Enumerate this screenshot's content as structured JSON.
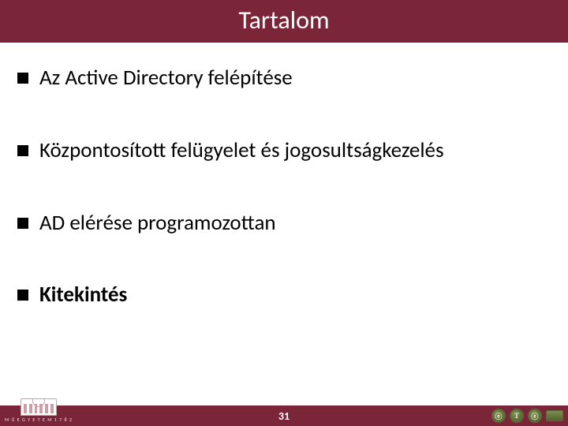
{
  "title": "Tartalom",
  "bullets": [
    {
      "text": "Az Active Directory felépítése",
      "bold": false
    },
    {
      "text": "Központosított felügyelet és jogosultságkezelés",
      "bold": false
    },
    {
      "text": "AD elérése programozottan",
      "bold": false
    },
    {
      "text": "Kitekintés",
      "bold": true
    }
  ],
  "page_number": "31",
  "logo_label": "M Ű E G Y E T E M  1 7 8 2",
  "badges": [
    "ⓔ",
    "T",
    "ⓔ",
    "■"
  ],
  "colors": {
    "brand": "#7a2638",
    "badge": "#5a6a39"
  }
}
